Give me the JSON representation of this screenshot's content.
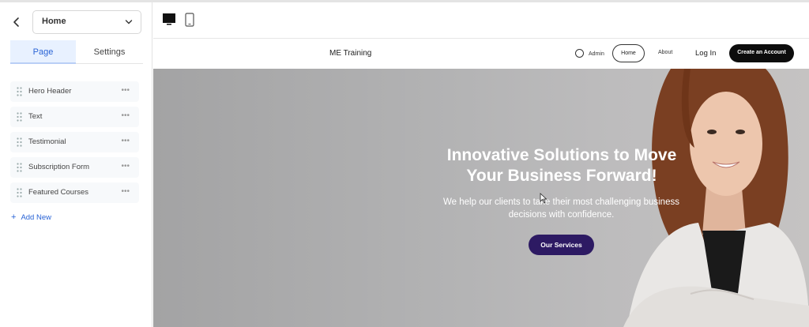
{
  "sidebar": {
    "page_select": "Home",
    "tabs": [
      {
        "label": "Page",
        "active": true
      },
      {
        "label": "Settings",
        "active": false
      }
    ],
    "sections": [
      {
        "label": "Hero Header"
      },
      {
        "label": "Text"
      },
      {
        "label": "Testimonial"
      },
      {
        "label": "Subscription Form"
      },
      {
        "label": "Featured Courses"
      }
    ],
    "more_glyph": "•••",
    "add_new": "Add New",
    "add_icon": "+"
  },
  "toolbar": {
    "devices": [
      "desktop-icon",
      "mobile-icon"
    ]
  },
  "site": {
    "brand": "ME Training",
    "nav": {
      "admin": "Admin",
      "home": "Home",
      "about": "About",
      "login": "Log In",
      "create_account": "Create an Account"
    },
    "hero": {
      "title_line1": "Innovative Solutions to Move",
      "title_line2": "Your Business Forward!",
      "subtitle_line1": "We help our clients to take their most challenging business",
      "subtitle_line2": "decisions with confidence.",
      "cta": "Our Services"
    }
  },
  "colors": {
    "accent": "#2a64d6",
    "cta": "#2d1a63",
    "create_button": "#0d0d0d"
  }
}
